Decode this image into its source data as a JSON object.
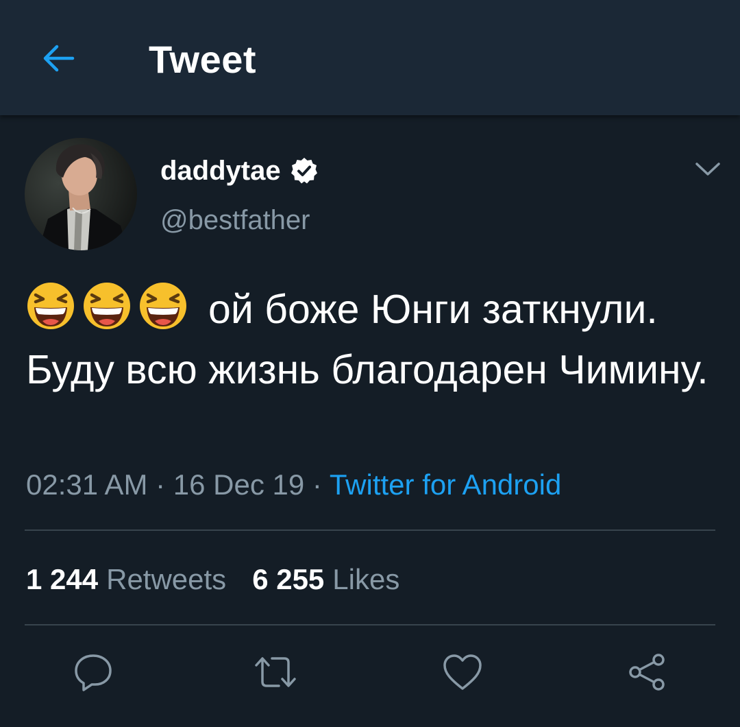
{
  "header": {
    "title": "Tweet",
    "back_icon": "arrow-left-icon"
  },
  "tweet": {
    "author": {
      "display_name": "daddytae",
      "handle": "@bestfather",
      "verified": true
    },
    "text_emoji": [
      "😆",
      "😆",
      "😆"
    ],
    "text_line1": "ой боже Юнги заткнули.",
    "text_rest": "Буду всю жизнь благодарен Чимину.",
    "time": "02:31 AM",
    "date": "16 Dec 19",
    "separator": " · ",
    "source": "Twitter for Android"
  },
  "stats": {
    "retweets_count": "1 244",
    "retweets_label": "Retweets",
    "likes_count": "6 255",
    "likes_label": "Likes"
  },
  "actions": [
    "reply-icon",
    "retweet-icon",
    "like-icon",
    "share-icon"
  ],
  "colors": {
    "background": "#141d26",
    "header": "#1b2836",
    "accent": "#1da1f2",
    "secondary_text": "#8899a6",
    "divider": "#38444d"
  }
}
